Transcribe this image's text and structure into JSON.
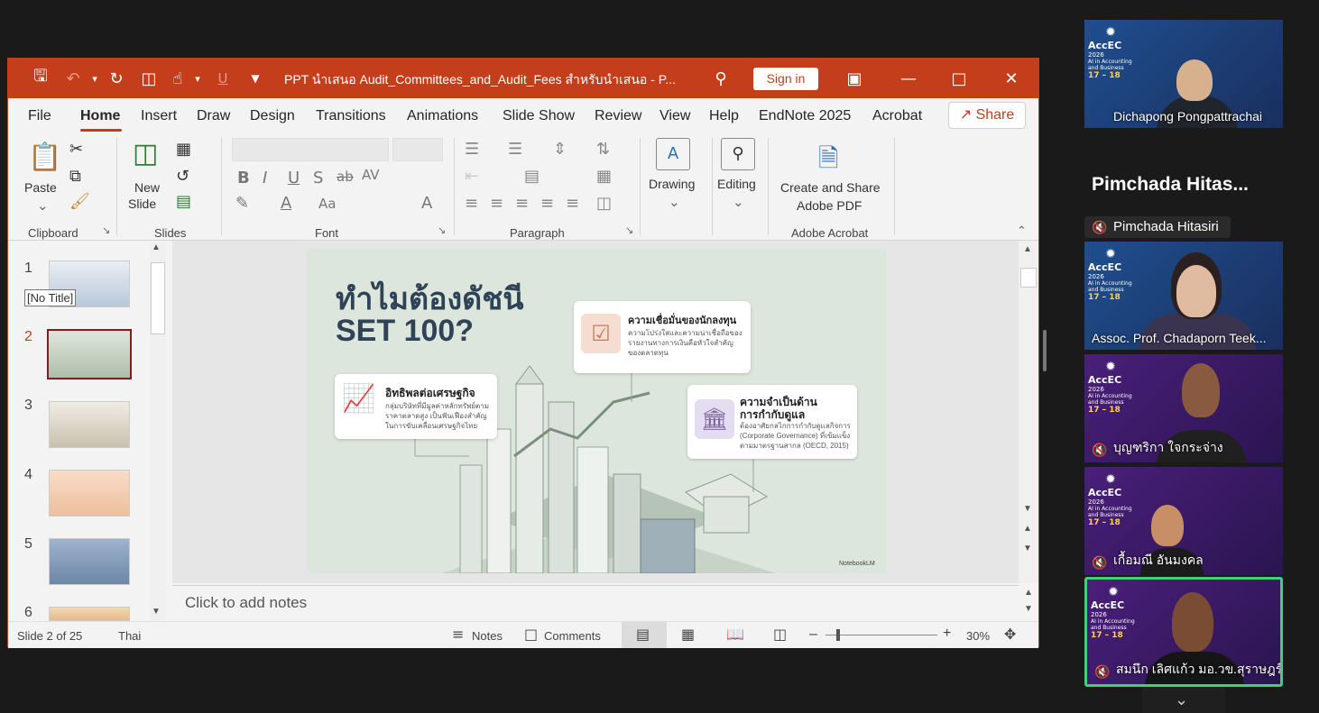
{
  "titlebar": {
    "doc_title": "PPT นำเสนอ Audit_Committees_and_Audit_Fees สำหรับนำเสนอ  -  P...",
    "sign_in": "Sign in"
  },
  "menu": {
    "items": [
      "File",
      "Home",
      "Insert",
      "Draw",
      "Design",
      "Transitions",
      "Animations",
      "Slide Show",
      "Review",
      "View",
      "Help",
      "EndNote 2025",
      "Acrobat"
    ],
    "share": "Share"
  },
  "ribbon": {
    "paste": "Paste",
    "new_slide_1": "New",
    "new_slide_2": "Slide",
    "drawing": "Drawing",
    "editing": "Editing",
    "create_share_1": "Create and Share",
    "create_share_2": "Adobe PDF",
    "groups": {
      "clipboard": "Clipboard",
      "slides": "Slides",
      "font": "Font",
      "paragraph": "Paragraph",
      "adobe": "Adobe Acrobat"
    }
  },
  "thumbnails": {
    "numbers": [
      "1",
      "2",
      "3",
      "4",
      "5",
      "6"
    ],
    "tooltip": "[No Title]",
    "selected": 2
  },
  "slide": {
    "title_1": "ทำไมต้องดัชนี",
    "title_2": "SET 100?",
    "card1_head": "ความเชื่อมั่นของนักลงทุน",
    "card1_body": "ความโปร่งใสและความน่าเชื่อถือของรายงานทางการเงินคือหัวใจสำคัญของตลาดทุน",
    "card2_head": "อิทธิพลต่อเศรษฐกิจ",
    "card2_body": "กลุ่มบริษัทที่มีมูลค่าหลักทรัพย์ตามราคาตลาดสูง เป็นฟันเฟืองสำคัญในการขับเคลื่อนเศรษฐกิจไทย",
    "card3_head_1": "ความจำเป็นด้าน",
    "card3_head_2": "การกำกับดูแล",
    "card3_body": "ต้องอาศัยกลไกการกำกับดูแลกิจการ (Corporate Governance) ที่เข้มแข็งตามมาตรฐานสากล (OECD, 2015)",
    "brand": "NotebookLM"
  },
  "notes": {
    "placeholder": "Click to add notes"
  },
  "status": {
    "slide_of": "Slide 2 of 25",
    "language": "Thai",
    "notes": "Notes",
    "comments": "Comments",
    "zoom": "30%"
  },
  "participants": {
    "tiles": [
      {
        "name": "Dichapong Pongpattrachai",
        "muted": false
      },
      {
        "name": "Assoc. Prof. Chadaporn  Teek...",
        "muted": false
      },
      {
        "name": "บุญฑริกา ใจกระจ่าง",
        "muted": true
      },
      {
        "name": "เกื้อมณี อันมงคล",
        "muted": true
      },
      {
        "name": "สมนึก เลิศแก้ว มอ.วข.สุราษฎร์ธานี",
        "muted": true
      }
    ],
    "audio_only_big": "Pimchada   Hitas...",
    "audio_only_name": "Pimchada  Hitasiri",
    "conf": {
      "brand": "AccEC",
      "year": "2026",
      "line1": "AI in Accounting",
      "line2": "and Business",
      "dates": "17 – 18"
    }
  },
  "colors": {
    "accent": "#c43e1c",
    "speaking_border": "#3fd07e"
  }
}
